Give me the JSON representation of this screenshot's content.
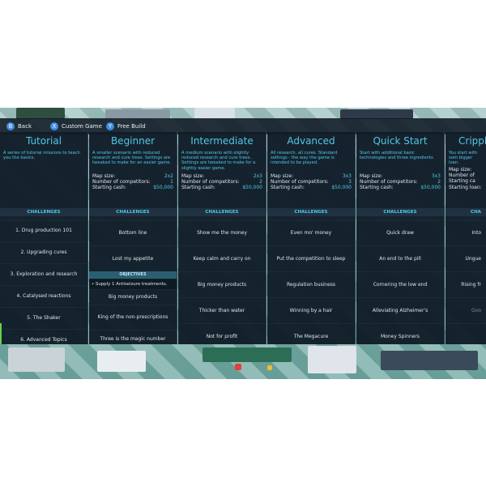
{
  "topbar": {
    "back": {
      "button_glyph": "B",
      "label": "Back"
    },
    "custom_game": {
      "button_glyph": "X",
      "label": "Custom Game"
    },
    "free_build": {
      "button_glyph": "Y",
      "label": "Free Build"
    }
  },
  "columns": [
    {
      "title": "Tutorial",
      "description": "A series of tutorial missions to teach you the basics.",
      "stats": [],
      "challenges_header": "CHALLENGES",
      "items": [
        "1. Drug production 101",
        "2. Upgrading cures",
        "3. Exploration and research",
        "4. Catalysed reactions",
        "5. The Shaker",
        "6. Advanced Topics"
      ]
    },
    {
      "title": "Beginner",
      "description": "A smaller scenario with reduced research and cure trees. Settings are tweaked to make for an easier game.",
      "stats": [
        {
          "label": "Map size:",
          "value": "2x2"
        },
        {
          "label": "Number of competitors:",
          "value": "1"
        },
        {
          "label": "Starting cash:",
          "value": "$50,000"
        }
      ],
      "challenges_header": "CHALLENGES",
      "items": [
        "Bottom line",
        "Lost my appetite",
        "Big money products",
        "King of the non-prescriptions",
        "Three is the magic number"
      ],
      "objectives_header": "OBJECTIVES",
      "objective": "Supply 1 Antiseizure treatments."
    },
    {
      "title": "Intermediate",
      "description": "A medium scenario with slightly reduced research and cure trees. Settings are tweaked to make for a slightly easier game.",
      "stats": [
        {
          "label": "Map size:",
          "value": "2x3"
        },
        {
          "label": "Number of competitors:",
          "value": "2"
        },
        {
          "label": "Starting cash:",
          "value": "$50,000"
        }
      ],
      "challenges_header": "CHALLENGES",
      "items": [
        "Show me the money",
        "Keep calm and carry on",
        "Big money products",
        "Thicker than water",
        "Not for profit"
      ]
    },
    {
      "title": "Advanced",
      "description": "All research, all cures. Standard settings - the way the game is intended to be played.",
      "stats": [
        {
          "label": "Map size:",
          "value": "3x3"
        },
        {
          "label": "Number of competitors:",
          "value": "3"
        },
        {
          "label": "Starting cash:",
          "value": "$50,000"
        }
      ],
      "challenges_header": "CHALLENGES",
      "items": [
        "Even mo' money",
        "Put the competition to sleep",
        "Regulation business",
        "Winning by a hair",
        "The Megacure"
      ]
    },
    {
      "title": "Quick Start",
      "description": "Start with additional basic technologies and three ingredients.",
      "stats": [
        {
          "label": "Map size:",
          "value": "3x3"
        },
        {
          "label": "Number of competitors:",
          "value": "2"
        },
        {
          "label": "Starting cash:",
          "value": "$50,000"
        }
      ],
      "challenges_header": "CHALLENGES",
      "items": [
        "Quick draw",
        "An end to the pill",
        "Cornering the low end",
        "Alleviating Alzheimer's",
        "Money Spinners"
      ]
    },
    {
      "title": "Crippl",
      "description": "You start with som bigger loan.",
      "stats": [
        {
          "label": "Map size:",
          "value": ""
        },
        {
          "label": "Number of",
          "value": ""
        },
        {
          "label": "Starting ca",
          "value": ""
        },
        {
          "label": "Starting loan:",
          "value": ""
        }
      ],
      "challenges_header": "CHA",
      "items": [
        "Into",
        "Ungue",
        "Rising fr",
        "Goo",
        ""
      ]
    }
  ]
}
